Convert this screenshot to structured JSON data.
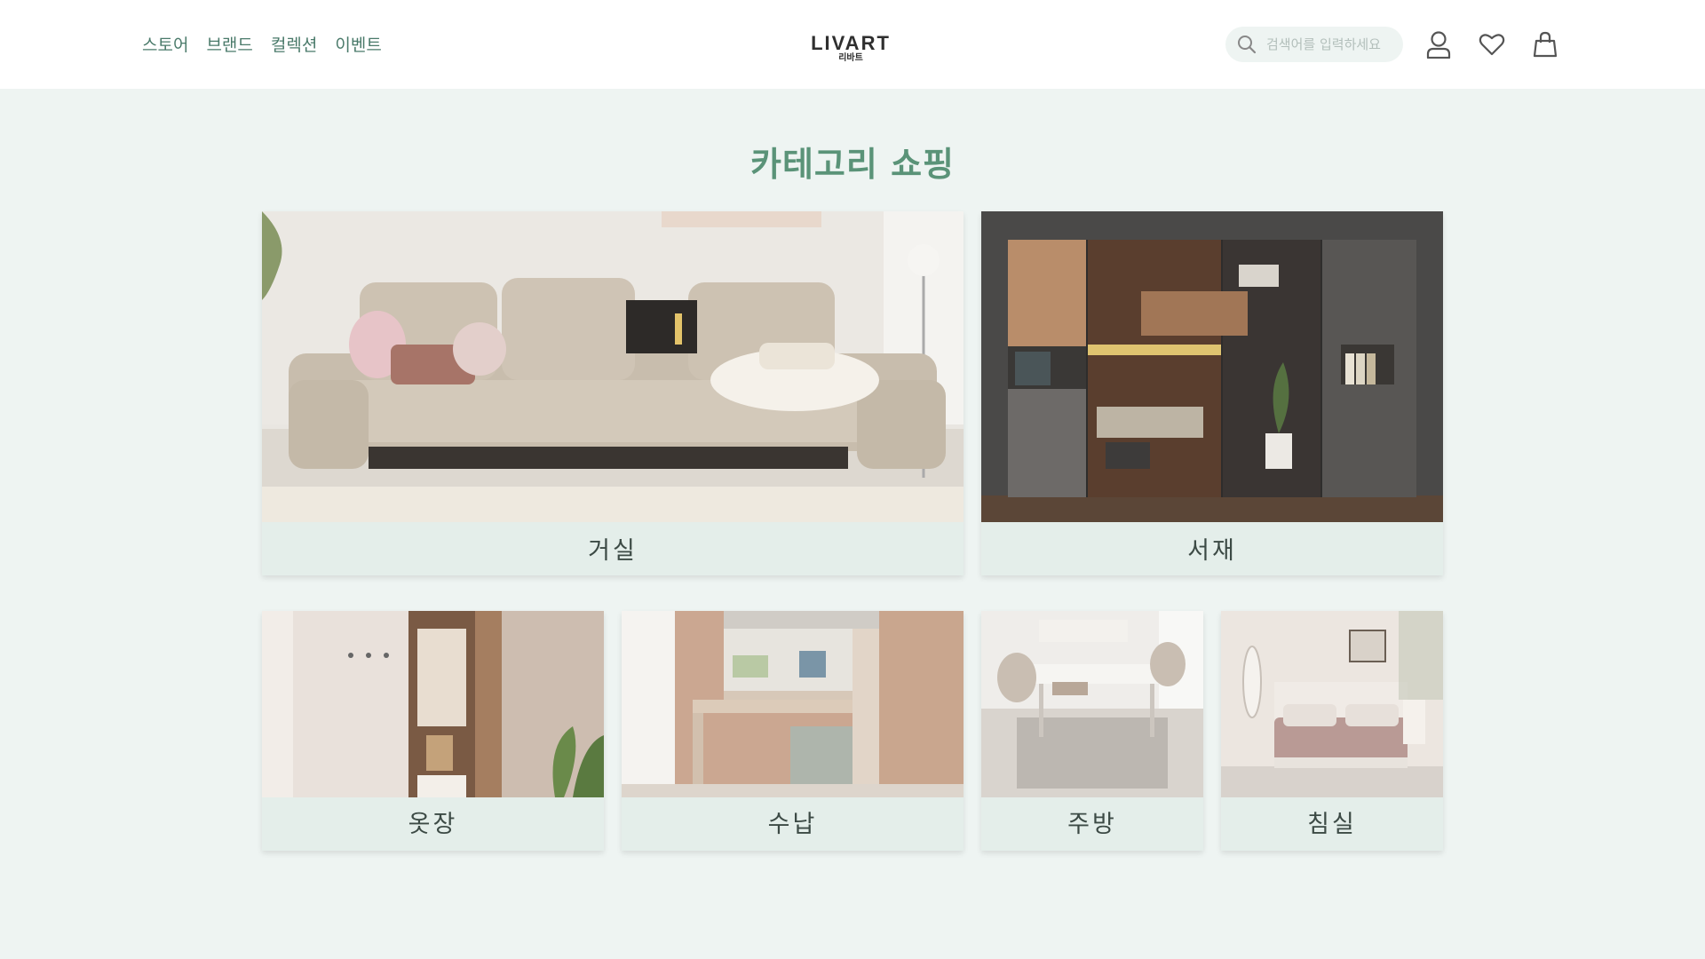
{
  "header": {
    "nav": [
      "스토어",
      "브랜드",
      "컬렉션",
      "이벤트"
    ],
    "logo": {
      "main": "LIVART",
      "sub": "리바트"
    },
    "search": {
      "placeholder": "검색어를 입력하세요"
    },
    "icons": [
      "search-icon",
      "user-icon",
      "heart-icon",
      "shopping-bag-icon"
    ]
  },
  "main": {
    "title": "카테고리 쇼핑",
    "categories": [
      {
        "label": "거실",
        "image": "living-room-sofa"
      },
      {
        "label": "서재",
        "image": "study-bookshelf"
      },
      {
        "label": "옷장",
        "image": "wardrobe"
      },
      {
        "label": "수납",
        "image": "storage-desk"
      },
      {
        "label": "주방",
        "image": "kitchen-dining-table"
      },
      {
        "label": "침실",
        "image": "bedroom-bed"
      }
    ]
  },
  "colors": {
    "accent": "#5a9378",
    "nav_text": "#4a7a6a",
    "page_bg": "#eef4f2",
    "card_bg": "#e4eeea",
    "header_bg": "#ffffff"
  }
}
